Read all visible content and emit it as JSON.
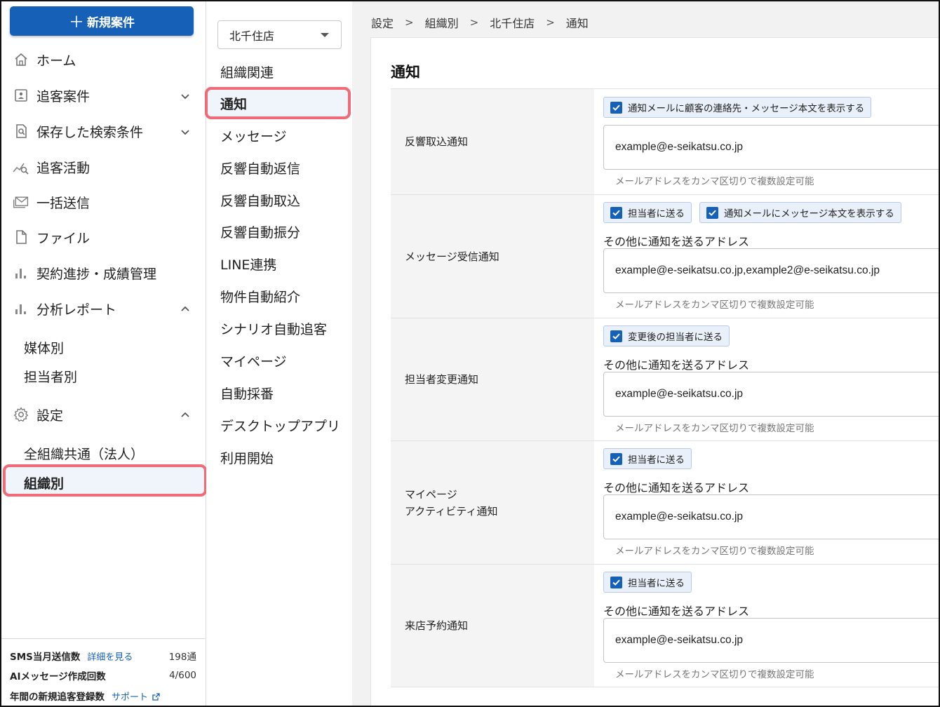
{
  "sidebar": {
    "new_button_label": "新規案件",
    "items": [
      {
        "label": "ホーム",
        "icon": "home-icon"
      },
      {
        "label": "追客案件",
        "icon": "id-card-icon"
      },
      {
        "label": "保存した検索条件",
        "icon": "saved-search-icon"
      },
      {
        "label": "追客活動",
        "icon": "activity-chart-icon"
      },
      {
        "label": "一括送信",
        "icon": "mail-icon"
      },
      {
        "label": "ファイル",
        "icon": "file-icon"
      },
      {
        "label": "契約進捗・成績管理",
        "icon": "bar-chart-icon"
      },
      {
        "label": "分析レポート",
        "icon": "bar-chart-icon"
      },
      {
        "label": "設定",
        "icon": "gear-icon"
      }
    ],
    "report_sub": [
      "媒体別",
      "担当者別"
    ],
    "settings_sub": [
      "全組織共通（法人）",
      "組織別"
    ],
    "stats": [
      {
        "label": "SMS当月送信数",
        "link": "詳細を見る",
        "value": "198通"
      },
      {
        "label": "AIメッセージ作成回数",
        "link": "",
        "value": "4/600"
      },
      {
        "label": "年間の新規追客登録数",
        "link": "サポート",
        "value": ""
      }
    ]
  },
  "middle": {
    "store": "北千住店",
    "items": [
      "組織関連",
      "通知",
      "メッセージ",
      "反響自動返信",
      "反響自動取込",
      "反響自動振分",
      "LINE連携",
      "物件自動紹介",
      "シナリオ自動追客",
      "マイページ",
      "自動採番",
      "デスクトップアプリ",
      "利用開始"
    ]
  },
  "breadcrumb": [
    "設定",
    "組織別",
    "北千住店",
    "通知"
  ],
  "main": {
    "title": "通知",
    "other_address_label": "その他に通知を送るアドレス",
    "hint": "メールアドレスをカンマ区切りで複数設定可能",
    "rows": [
      {
        "label": "反響取込通知",
        "checks": [
          "通知メールに顧客の連絡先・メッセージ本文を表示する"
        ],
        "email": "example@e-seikatsu.co.jp"
      },
      {
        "label": "メッセージ受信通知",
        "checks": [
          "担当者に送る",
          "通知メールにメッセージ本文を表示する"
        ],
        "email": "example@e-seikatsu.co.jp,example2@e-seikatsu.co.jp"
      },
      {
        "label": "担当者変更通知",
        "checks": [
          "変更後の担当者に送る"
        ],
        "email": "example@e-seikatsu.co.jp"
      },
      {
        "label_line1": "マイページ",
        "label_line2": "アクティビティ通知",
        "checks": [
          "担当者に送る"
        ],
        "email": "example@e-seikatsu.co.jp"
      },
      {
        "label": "来店予約通知",
        "checks": [
          "担当者に送る"
        ],
        "email": "example@e-seikatsu.co.jp"
      }
    ]
  },
  "colors": {
    "accent": "#1660b8",
    "highlight": "#f06a78"
  }
}
